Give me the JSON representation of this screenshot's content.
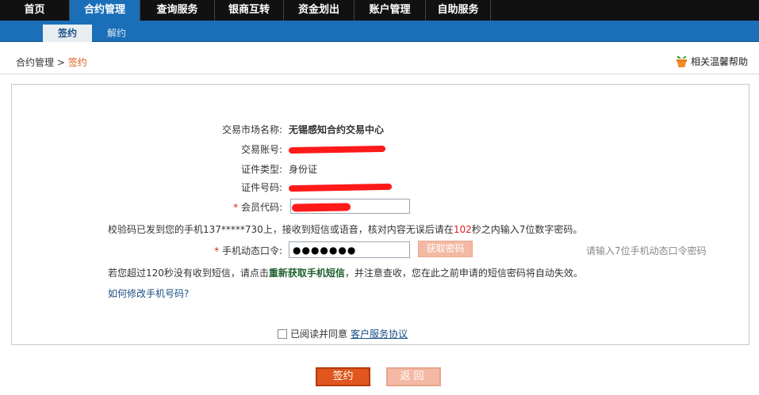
{
  "topnav": {
    "items": [
      {
        "label": "首页"
      },
      {
        "label": "合约管理"
      },
      {
        "label": "查询服务"
      },
      {
        "label": "银商互转"
      },
      {
        "label": "资金划出"
      },
      {
        "label": "账户管理"
      },
      {
        "label": "自助服务"
      }
    ],
    "active_index": 1
  },
  "subnav": {
    "active": "签约",
    "inactive": "解约"
  },
  "breadcrumb": {
    "parent": "合约管理",
    "separator": ">",
    "current": "签约"
  },
  "help": {
    "label": "相关温馨帮助"
  },
  "form": {
    "market_label": "交易市场名称:",
    "market_value": "无锡感知合约交易中心",
    "account_label": "交易账号:",
    "id_type_label": "证件类型:",
    "id_type_value": "身份证",
    "id_no_label": "证件号码:",
    "member_label": "会员代码:",
    "required_mark": "*",
    "sms_notice_pre": "校验码已发到您的手机137*****730上，接收到短信或语音，核对内容无误后请在",
    "sms_countdown": "102",
    "sms_notice_post": "秒之内输入7位数字密码。",
    "otp_label": "手机动态口令:",
    "otp_value": "●●●●●●●",
    "get_code_button": "获取密码",
    "otp_hint": "请输入7位手机动态口令密码",
    "resend_pre": "若您超过120秒没有收到短信，请点击",
    "resend_link": "重新获取手机短信",
    "resend_post": "，并注意查收，您在此之前申请的短信密码将自动失效。",
    "change_phone_link": "如何修改手机号码?",
    "agree_text": "已阅读并同意",
    "agreement_link": "客户服务协议"
  },
  "buttons": {
    "sign": "签约",
    "back": "返回"
  },
  "colors": {
    "nav_bg": "#111111",
    "nav_active": "#1a6fb8",
    "accent": "#e0561e",
    "countdown": "#e02020"
  }
}
